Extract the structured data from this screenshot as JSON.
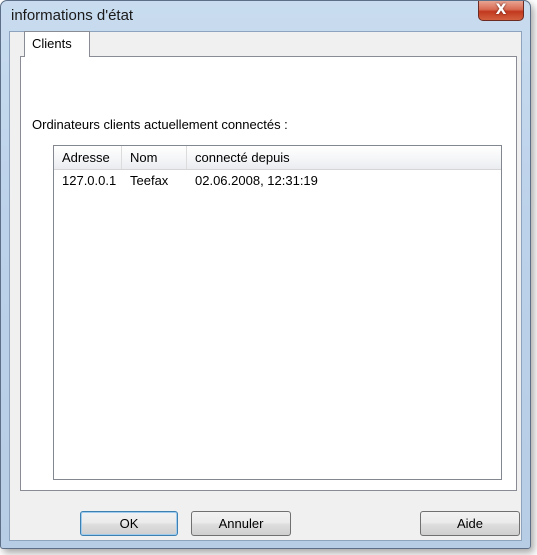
{
  "window": {
    "title": "informations d'état",
    "close_glyph": "X"
  },
  "tabs": [
    {
      "label": "Clients",
      "selected": true
    }
  ],
  "panel": {
    "description": "Ordinateurs clients actuellement connectés :"
  },
  "list": {
    "columns": [
      "Adresse",
      "Nom",
      "connecté depuis"
    ],
    "rows": [
      [
        "127.0.0.1",
        "Teefax",
        "02.06.2008, 12:31:19"
      ]
    ]
  },
  "buttons": {
    "ok": "OK",
    "cancel": "Annuler",
    "help": "Aide"
  },
  "colors": {
    "frame": "#bcd2ea",
    "close_button": "#c94a30",
    "default_button_border": "#3c7fb1"
  }
}
